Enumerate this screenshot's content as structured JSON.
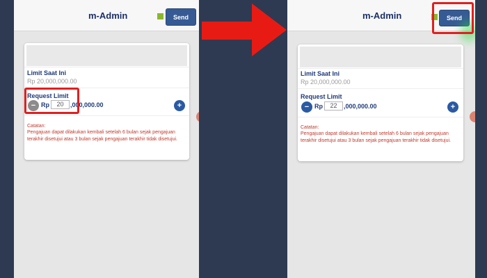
{
  "app": {
    "title": "m-Admin",
    "send_label": "Send"
  },
  "colors": {
    "accent": "#365b94",
    "status": "#8ab82d",
    "note": "#c0392b",
    "highlight": "#e01f1f",
    "arrow": "#e81b14"
  },
  "before": {
    "current_limit_label": "Limit Saat Ini",
    "current_limit_value": "Rp 20,000,000.00",
    "request_label": "Request Limit",
    "rp": "Rp",
    "amount_input": "20",
    "amount_rest": ",000,000.00",
    "minus_icon": "−",
    "plus_icon": "+",
    "note_title": "Catatan:",
    "note_text": "Pengajuan dapat dilakukan kembali setelah 6 bulan sejak pengajuan terakhir disetujui atau 3 bulan sejak pengajuan terakhir tidak disetujui."
  },
  "after": {
    "current_limit_label": "Limit Saat Ini",
    "current_limit_value": "Rp 20,000,000.00",
    "request_label": "Request Limit",
    "rp": "Rp",
    "amount_input": "22",
    "amount_rest": ",000,000.00",
    "minus_icon": "−",
    "plus_icon": "+",
    "note_title": "Catatan:",
    "note_text": "Pengajuan dapat dilakukan kembali setelah 6 bulan sejak pengajuan terakhir disetujui atau 3 bulan sejak pengajuan terakhir tidak disetujui."
  }
}
